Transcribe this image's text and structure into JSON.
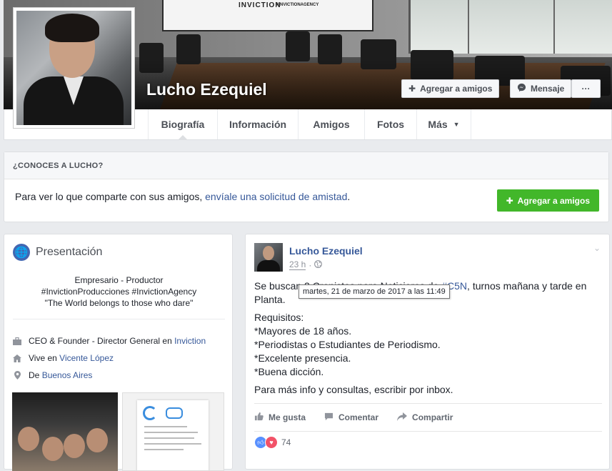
{
  "cover": {
    "brand": "INVICTION",
    "tag": "#INVICTIONAGENCY"
  },
  "profile": {
    "name": "Lucho Ezequiel",
    "add_friend": "Agregar a amigos",
    "message": "Mensaje",
    "more": "···"
  },
  "tabs": [
    {
      "label": "Biografía"
    },
    {
      "label": "Información"
    },
    {
      "label": "Amigos"
    },
    {
      "label": "Fotos"
    },
    {
      "label": "Más"
    }
  ],
  "know_box": {
    "header": "¿CONOCES A LUCHO?",
    "text_prefix": "Para ver lo que comparte con sus amigos, ",
    "link": "envíale una solicitud de amistad",
    "text_suffix": ".",
    "button": "Agregar a amigos"
  },
  "intro": {
    "title": "Presentación",
    "bio_lines": [
      "Empresario - Productor",
      "#InvictionProducciones #InvictionAgency",
      "\"The World belongs to those who dare\""
    ],
    "work_prefix": "CEO & Founder - Director General en ",
    "work_link": "Inviction",
    "lives_prefix": "Vive en ",
    "lives_link": "Vicente López",
    "from_prefix": "De ",
    "from_link": "Buenos Aires"
  },
  "post": {
    "author": "Lucho Ezequiel",
    "time": "23 h",
    "tooltip": "martes, 21 de marzo de 2017 a las 11:49",
    "line1_prefix": "Se buscan 2 Cronistas para Noticieros de ",
    "hashtag": "#C5N",
    "line1_suffix": ", turnos mañana y tarde en Planta.",
    "req_title": "Requisitos:",
    "req_items": [
      "*Mayores de 18 años.",
      "*Periodistas o Estudiantes de Periodismo.",
      "*Excelente presencia.",
      "*Buena dicción."
    ],
    "closing": "Para más info y consultas, escribir por inbox.",
    "like": "Me gusta",
    "comment": "Comentar",
    "share": "Compartir",
    "reaction_count": "74"
  },
  "colors": {
    "link": "#365899",
    "green": "#42b72a",
    "like": "#5890ff",
    "love": "#f25268"
  }
}
